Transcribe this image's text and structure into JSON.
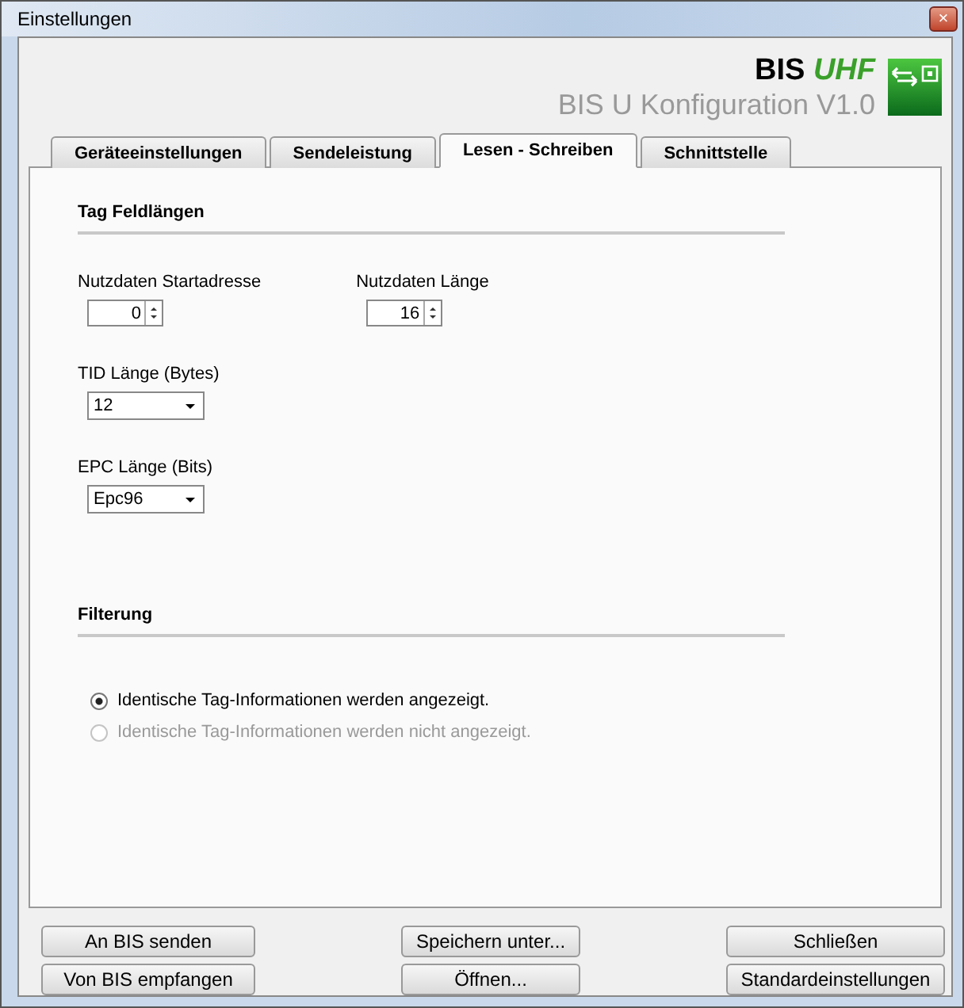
{
  "window": {
    "title": "Einstellungen",
    "close": "×"
  },
  "header": {
    "brand": "BIS",
    "brand_accent": "UHF",
    "subtitle": "BIS U Konfiguration V1.0"
  },
  "tabs": [
    {
      "label": "Geräteeinstellungen",
      "selected": false
    },
    {
      "label": "Sendeleistung",
      "selected": false
    },
    {
      "label": "Lesen - Schreiben",
      "selected": true
    },
    {
      "label": "Schnittstelle",
      "selected": false
    }
  ],
  "tag_section": {
    "title": "Tag Feldlängen",
    "spinners": [
      {
        "label": "Nutzdaten Startadresse",
        "value": "0"
      },
      {
        "label": "Nutzdaten Länge",
        "value": "16"
      }
    ],
    "dropdowns": [
      {
        "label": "TID Länge (Bytes)",
        "value": "12"
      },
      {
        "label": "EPC Länge (Bits)",
        "value": "Epc96"
      }
    ]
  },
  "filter_section": {
    "title": "Filterung",
    "options": [
      {
        "label": "Identische Tag-Informationen werden angezeigt.",
        "selected": true,
        "disabled": false
      },
      {
        "label": "Identische Tag-Informationen werden nicht angezeigt.",
        "selected": false,
        "disabled": true
      }
    ]
  },
  "buttons": [
    [
      "An BIS senden",
      "Von BIS empfangen"
    ],
    [
      "Speichern unter...",
      "Öffnen..."
    ],
    [
      "Schließen",
      "Standardeinstellungen"
    ]
  ]
}
